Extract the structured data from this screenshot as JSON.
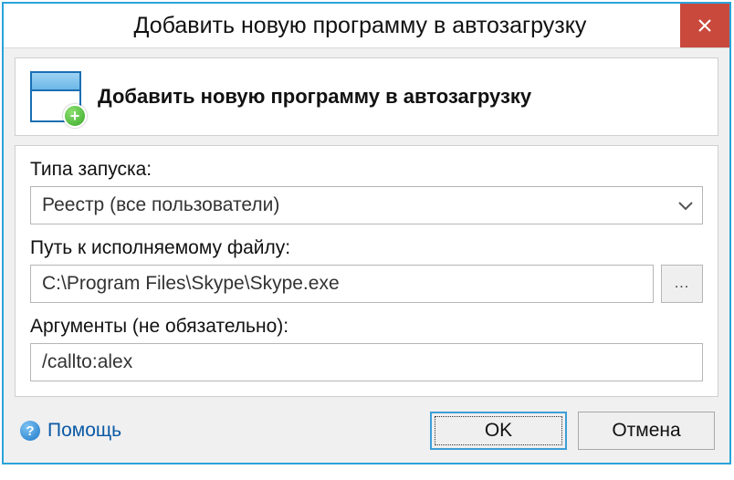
{
  "window": {
    "title": "Добавить новую программу в автозагрузку"
  },
  "header": {
    "title": "Добавить новую программу в автозагрузку"
  },
  "form": {
    "launch_type_label": "Типа запуска:",
    "launch_type_value": "Реестр (все пользователи)",
    "path_label": "Путь к исполняемому файлу:",
    "path_value": "C:\\Program Files\\Skype\\Skype.exe",
    "browse_label": "...",
    "args_label": "Аргументы (не обязательно):",
    "args_value": "/callto:alex"
  },
  "footer": {
    "help_label": "Помощь",
    "ok_label": "OK",
    "cancel_label": "Отмена"
  }
}
